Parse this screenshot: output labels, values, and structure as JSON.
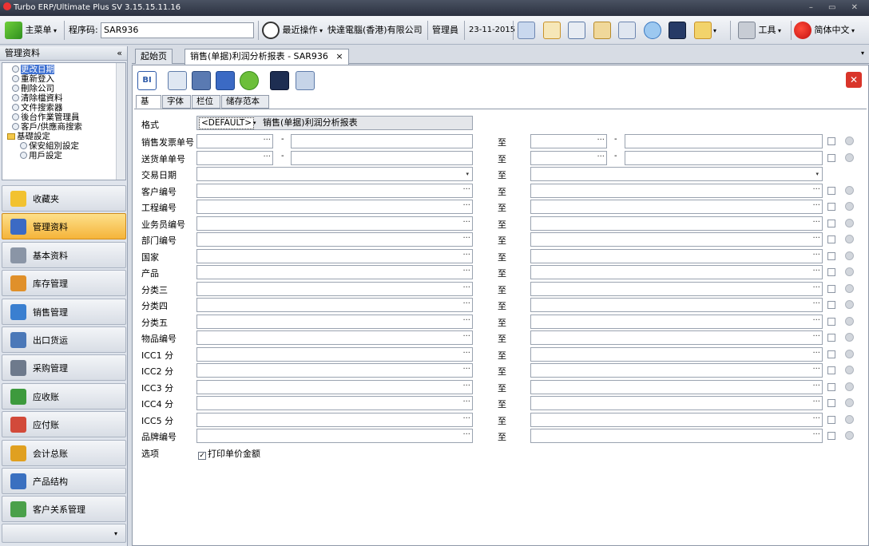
{
  "window": {
    "title": "Turbo ERP/Ultimate Plus SV 3.15.15.11.16",
    "controls": "– ▭ ✕"
  },
  "toolbar": {
    "main_menu": "主菜单",
    "program_code_label": "程序码:",
    "program_code_value": "SAR936",
    "recent_ops": "最近操作",
    "company": "快達電腦(香港)有限公司",
    "user": "管理員",
    "date": "23-11-2015",
    "tools": "工具",
    "language": "简体中文"
  },
  "sidebar": {
    "header": "管理资料",
    "collapse": "«",
    "tree": [
      {
        "label": "更改日期",
        "type": "item",
        "selected": true,
        "indent": 1
      },
      {
        "label": "重新登入",
        "type": "item",
        "indent": 1
      },
      {
        "label": "刪除公司",
        "type": "item",
        "indent": 1
      },
      {
        "label": "清除檔資料",
        "type": "item",
        "indent": 1
      },
      {
        "label": "文件搜索器",
        "type": "item",
        "indent": 1
      },
      {
        "label": "後台作業管理員",
        "type": "item",
        "indent": 1
      },
      {
        "label": "客戶/供應商搜索",
        "type": "item",
        "indent": 1
      },
      {
        "label": "基礎設定",
        "type": "folder",
        "indent": 0
      },
      {
        "label": "保安組別設定",
        "type": "item",
        "indent": 2
      },
      {
        "label": "用戶設定",
        "type": "item",
        "indent": 2
      }
    ],
    "nav": [
      {
        "label": "收藏夹",
        "color": "#f2c230"
      },
      {
        "label": "管理资料",
        "color": "#3b6ac4",
        "active": true
      },
      {
        "label": "基本资料",
        "color": "#8a95a6"
      },
      {
        "label": "库存管理",
        "color": "#e0902a"
      },
      {
        "label": "销售管理",
        "color": "#3a7fd0"
      },
      {
        "label": "出口货运",
        "color": "#4b78b8"
      },
      {
        "label": "采购管理",
        "color": "#6e7a8c"
      },
      {
        "label": "应收账",
        "color": "#3d9a3d"
      },
      {
        "label": "应付账",
        "color": "#d24a3a"
      },
      {
        "label": "会计总账",
        "color": "#e0a020"
      },
      {
        "label": "产品结构",
        "color": "#3a70c0"
      },
      {
        "label": "客户关系管理",
        "color": "#4aa04a"
      }
    ]
  },
  "tabs": [
    {
      "label": "起始页"
    },
    {
      "label": "销售(单据)利润分析报表 - SAR936",
      "close": "×",
      "active": true
    }
  ],
  "subtabs": [
    "基本",
    "字体",
    "栏位",
    "储存范本"
  ],
  "form": {
    "format_label": "格式",
    "format_value": "<DEFAULT>",
    "format_name": "销售(单据)利润分析报表",
    "to_label": "至",
    "dash": "-",
    "dots": "···",
    "rows": [
      {
        "label": "销售发票单号",
        "kind": "split"
      },
      {
        "label": "送货单单号",
        "kind": "split"
      },
      {
        "label": "交易日期",
        "kind": "date"
      },
      {
        "label": "客户编号",
        "kind": "lookup"
      },
      {
        "label": "工程编号",
        "kind": "lookup"
      },
      {
        "label": "业务员编号",
        "kind": "lookup"
      },
      {
        "label": "部门编号",
        "kind": "lookup"
      },
      {
        "label": "国家",
        "kind": "lookup"
      },
      {
        "label": "产品",
        "kind": "lookup"
      },
      {
        "label": "分类三",
        "kind": "lookup"
      },
      {
        "label": "分类四",
        "kind": "lookup"
      },
      {
        "label": "分类五",
        "kind": "lookup"
      },
      {
        "label": "物品编号",
        "kind": "lookup"
      },
      {
        "label": "ICC1 分",
        "kind": "lookup"
      },
      {
        "label": "ICC2 分",
        "kind": "lookup"
      },
      {
        "label": "ICC3 分",
        "kind": "lookup"
      },
      {
        "label": "ICC4 分",
        "kind": "lookup"
      },
      {
        "label": "ICC5 分",
        "kind": "lookup"
      },
      {
        "label": "品牌编号",
        "kind": "lookup"
      }
    ],
    "options_label": "选项",
    "option_print_unit_price": "打印单价金额",
    "option_print_unit_price_checked": true
  }
}
